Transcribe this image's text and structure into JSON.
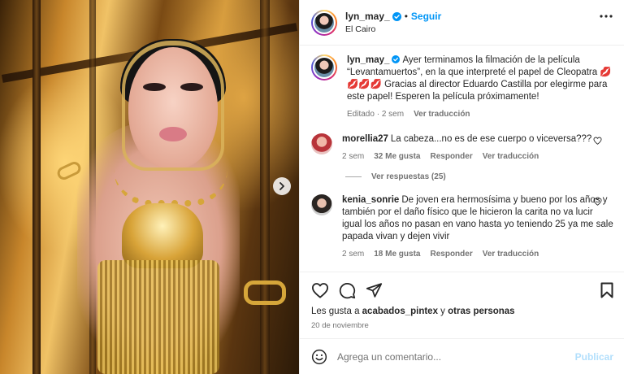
{
  "post": {
    "username": "lyn_may_",
    "follow_label": "Seguir",
    "separator": "•",
    "location": "El Cairo",
    "caption": {
      "text": "Ayer terminamos la filmación de la película “Levantamuertos”, en la que interpreté el papel de Cleopatra 💋💋💋💋 Gracias al director Eduardo Castilla por elegirme para este papel! Esperen la película próximamente!",
      "edited": "Editado",
      "dot": "·",
      "time": "2 sem",
      "translate": "Ver traducción"
    }
  },
  "comments": [
    {
      "username": "morellia27",
      "text": "La cabeza...no es de ese cuerpo o viceversa???",
      "time": "2 sem",
      "likes": "32 Me gusta",
      "reply": "Responder",
      "translate": "Ver traducción",
      "view_replies": "Ver respuestas (25)"
    },
    {
      "username": "kenia_sonrie",
      "text": "De joven era hermosísima y bueno por los años y también por el daño físico que le hicieron la carita no va lucir igual los años no pasan en vano hasta yo teniendo 25 ya me sale papada vivan y dejen vivir",
      "time": "2 sem",
      "likes": "18 Me gusta",
      "reply": "Responder",
      "translate": "Ver traducción"
    }
  ],
  "likes_summary": {
    "prefix": "Les gusta a ",
    "user": "acabados_pintex",
    "middle": " y ",
    "others": "otras personas"
  },
  "date": "20 de noviembre",
  "add_comment": {
    "placeholder": "Agrega un comentario...",
    "publish": "Publicar"
  },
  "icons": {
    "verified": "verified-badge-icon",
    "more": "more-options-icon",
    "like": "heart-icon",
    "comment": "comment-icon",
    "share": "share-icon",
    "save": "bookmark-icon",
    "emoji": "emoji-icon",
    "next": "chevron-right-icon"
  },
  "colors": {
    "accent": "#0095f6",
    "publish_disabled": "#b2dffc",
    "muted": "#737373"
  }
}
